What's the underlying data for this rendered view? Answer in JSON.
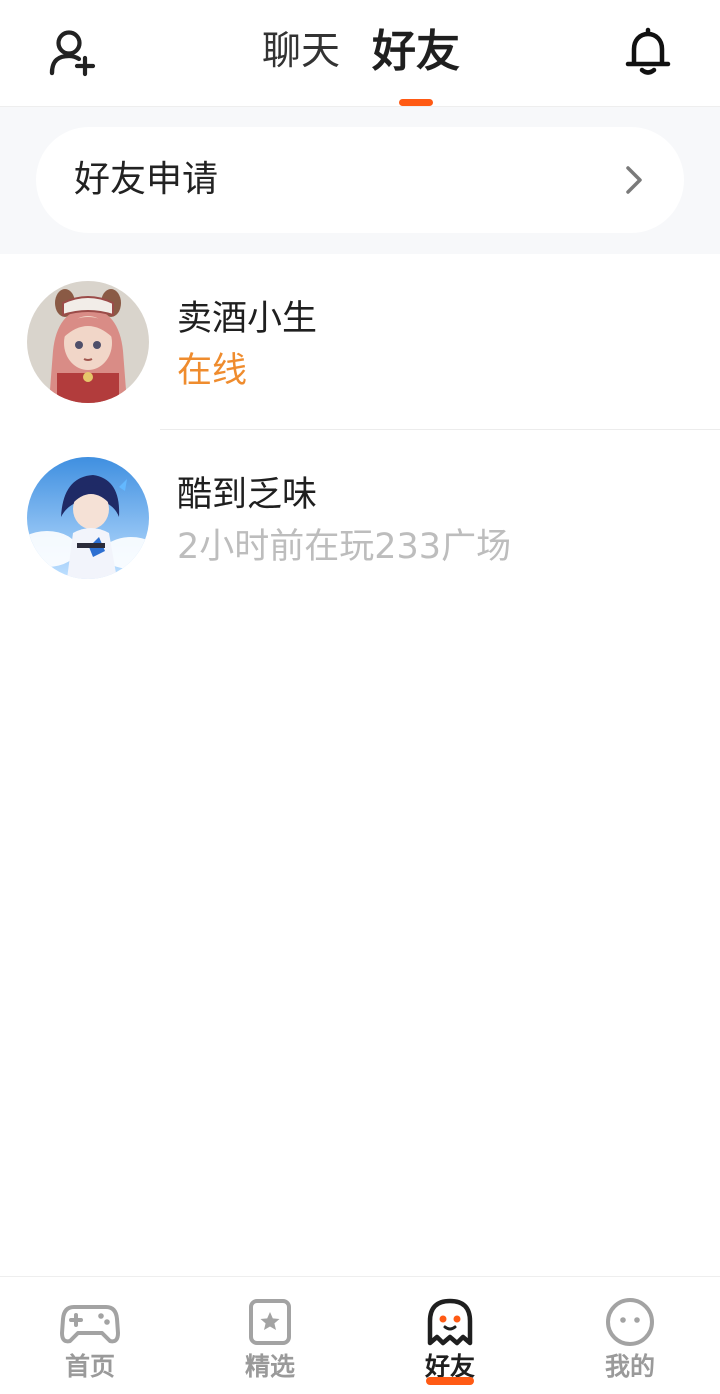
{
  "header": {
    "tabs": [
      {
        "label": "聊天",
        "active": false
      },
      {
        "label": "好友",
        "active": true
      }
    ],
    "left_icon": "add-friend-icon",
    "right_icon": "bell-icon"
  },
  "friend_request": {
    "label": "好友申请",
    "icon": "chevron-right-icon"
  },
  "friends": [
    {
      "name": "卖酒小生",
      "status": "在线",
      "status_color": "#ef8c2e",
      "avatar": "anime-girl-pink-hair-avatar"
    },
    {
      "name": "酷到乏味",
      "status": "2小时前在玩233广场",
      "status_color": "#bdbdbd",
      "avatar": "anime-girl-blue-sky-avatar"
    }
  ],
  "bottom_nav": [
    {
      "label": "首页",
      "icon": "gamepad-icon",
      "active": false
    },
    {
      "label": "精选",
      "icon": "star-icon",
      "active": false
    },
    {
      "label": "好友",
      "icon": "ghost-icon",
      "active": true
    },
    {
      "label": "我的",
      "icon": "face-icon",
      "active": false
    }
  ],
  "colors": {
    "accent": "#ff5a14",
    "online": "#ef8c2e",
    "muted": "#bdbdbd",
    "band_bg": "#f7f8fa"
  }
}
